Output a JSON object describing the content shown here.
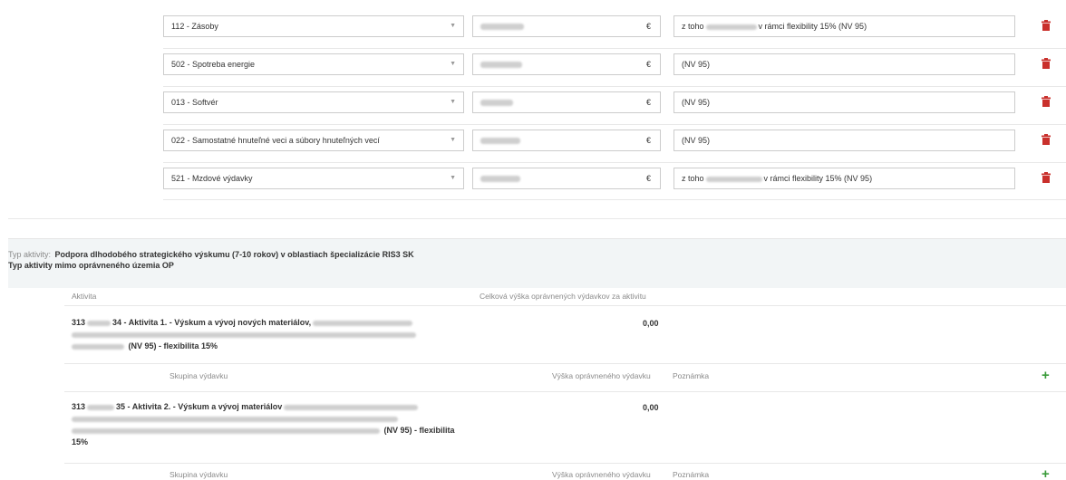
{
  "expense_rows": [
    {
      "category": "112 - Zásoby",
      "currency": "€",
      "note_before": "z toho",
      "note_after": "v rámci flexibility 15%   (NV 95)"
    },
    {
      "category": "502 - Spotreba energie",
      "currency": "€",
      "note_before": "",
      "note_after": "(NV 95)"
    },
    {
      "category": "013 - Softvér",
      "currency": "€",
      "note_before": "",
      "note_after": "(NV 95)"
    },
    {
      "category": "022 - Samostatné hnuteľné veci a súbory hnuteľných vecí",
      "currency": "€",
      "note_before": "",
      "note_after": "(NV 95)"
    },
    {
      "category": "521 - Mzdové výdavky",
      "currency": "€",
      "note_before": "z toho",
      "note_after": "v rámci flexibility 15%   (NV 95)"
    }
  ],
  "activity_type": {
    "label": "Typ aktivity:",
    "value": "Podpora dlhodobého strategického výskumu (7-10 rokov) v oblastiach špecializácie RIS3 SK",
    "outside_label": "Typ aktivity mimo oprávneného územia OP"
  },
  "columns": {
    "activity": "Aktivita",
    "total": "Celková výška oprávnených výdavkov za aktivitu"
  },
  "activities": [
    {
      "code_prefix": "313",
      "code_suffix": "34 - Aktivita 1. - Výskum a vývoj nových materiálov,",
      "tail": "(NV 95) - flexibilita 15%",
      "total": "0,00"
    },
    {
      "code_prefix": "313",
      "code_suffix": "35 - Aktivita 2. - Výskum a vývoj materiálov",
      "tail": "(NV 95) - flexibilita",
      "tail2": "15%",
      "total": "0,00"
    }
  ],
  "sub_columns": {
    "group": "Skupina výdavku",
    "amount": "Výška oprávneného výdavku",
    "note": "Poznámka"
  },
  "colors": {
    "danger": "#c9302c",
    "success": "#3a9b3a"
  },
  "icons": {
    "delete": "trash-icon",
    "add": "plus-icon",
    "select": "chevron-down-icon"
  }
}
